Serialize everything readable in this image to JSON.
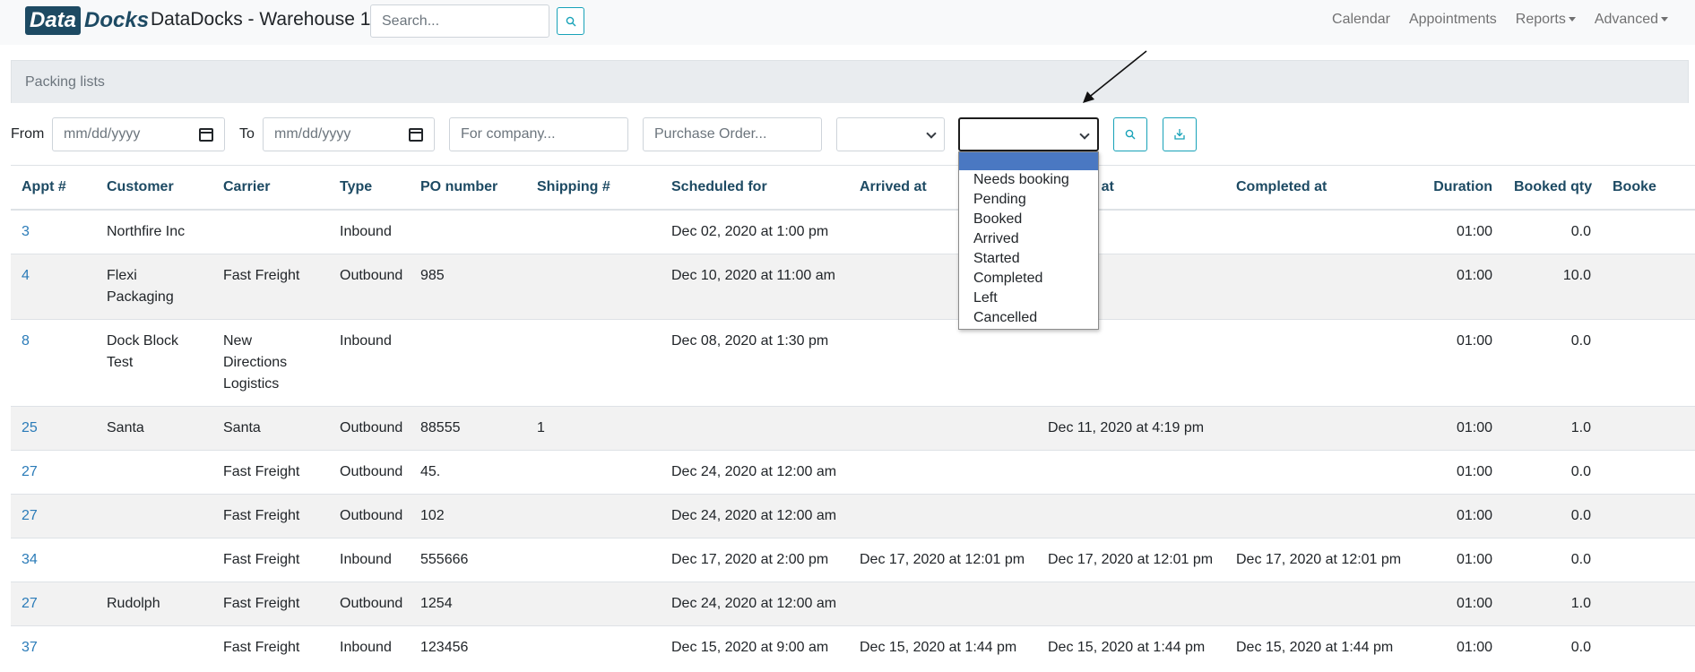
{
  "header": {
    "logo_part1": "Data",
    "logo_part2": "Docks",
    "title": "DataDocks - Warehouse 1",
    "search_placeholder": "Search...",
    "nav": [
      "Calendar",
      "Appointments",
      "Reports",
      "Advanced"
    ]
  },
  "card": {
    "title": "Packing lists"
  },
  "filters": {
    "from_label": "From",
    "to_label": "To",
    "from_placeholder": "mm/dd/yyyy",
    "to_placeholder": "mm/dd/yyyy",
    "company_placeholder": "For company...",
    "po_placeholder": "Purchase Order...",
    "type_select_value": "",
    "status_select_value": "",
    "status_options": [
      "",
      "Needs booking",
      "Pending",
      "Booked",
      "Arrived",
      "Started",
      "Completed",
      "Left",
      "Cancelled"
    ]
  },
  "table": {
    "columns": [
      "Appt #",
      "Customer",
      "Carrier",
      "Type",
      "PO number",
      "Shipping #",
      "Scheduled for",
      "Arrived at",
      "Started at",
      "Completed at",
      "Duration",
      "Booked qty",
      "Booked"
    ],
    "visible_headers": {
      "started": "at",
      "last": "Booke"
    },
    "rows": [
      {
        "appt": "3",
        "customer": "Northfire Inc",
        "carrier": "",
        "type": "Inbound",
        "po": "",
        "shipping": "",
        "scheduled": "Dec 02, 2020 at 1:00 pm",
        "arrived": "",
        "started": "",
        "completed": "",
        "duration": "01:00",
        "qty": "0.0"
      },
      {
        "appt": "4",
        "customer": "Flexi Packaging",
        "carrier": "Fast Freight",
        "type": "Outbound",
        "po": "985",
        "shipping": "",
        "scheduled": "Dec 10, 2020 at 11:00 am",
        "arrived": "",
        "started": "",
        "completed": "",
        "duration": "01:00",
        "qty": "10.0"
      },
      {
        "appt": "8",
        "customer": "Dock Block Test",
        "carrier": "New Directions Logistics",
        "type": "Inbound",
        "po": "",
        "shipping": "",
        "scheduled": "Dec 08, 2020 at 1:30 pm",
        "arrived": "",
        "started": "",
        "completed": "",
        "duration": "01:00",
        "qty": "0.0"
      },
      {
        "appt": "25",
        "customer": "Santa",
        "carrier": "Santa",
        "type": "Outbound",
        "po": "88555",
        "shipping": "1",
        "scheduled": "",
        "arrived": "",
        "started": "Dec 11, 2020 at 4:19 pm",
        "completed": "",
        "duration": "01:00",
        "qty": "1.0"
      },
      {
        "appt": "27",
        "customer": "",
        "carrier": "Fast Freight",
        "type": "Outbound",
        "po": "45.",
        "shipping": "",
        "scheduled": "Dec 24, 2020 at 12:00 am",
        "arrived": "",
        "started": "",
        "completed": "",
        "duration": "01:00",
        "qty": "0.0"
      },
      {
        "appt": "27",
        "customer": "",
        "carrier": "Fast Freight",
        "type": "Outbound",
        "po": "102",
        "shipping": "",
        "scheduled": "Dec 24, 2020 at 12:00 am",
        "arrived": "",
        "started": "",
        "completed": "",
        "duration": "01:00",
        "qty": "0.0"
      },
      {
        "appt": "34",
        "customer": "",
        "carrier": "Fast Freight",
        "type": "Inbound",
        "po": "555666",
        "shipping": "",
        "scheduled": "Dec 17, 2020 at 2:00 pm",
        "arrived": "Dec 17, 2020 at 12:01 pm",
        "started": "Dec 17, 2020 at 12:01 pm",
        "completed": "Dec 17, 2020 at 12:01 pm",
        "duration": "01:00",
        "qty": "0.0"
      },
      {
        "appt": "27",
        "customer": "Rudolph",
        "carrier": "Fast Freight",
        "type": "Outbound",
        "po": "1254",
        "shipping": "",
        "scheduled": "Dec 24, 2020 at 12:00 am",
        "arrived": "",
        "started": "",
        "completed": "",
        "duration": "01:00",
        "qty": "1.0"
      },
      {
        "appt": "37",
        "customer": "",
        "carrier": "Fast Freight",
        "type": "Inbound",
        "po": "123456",
        "shipping": "",
        "scheduled": "Dec 15, 2020 at 9:00 am",
        "arrived": "Dec 15, 2020 at 1:44 pm",
        "started": "Dec 15, 2020 at 1:44 pm",
        "completed": "Dec 15, 2020 at 1:44 pm",
        "duration": "01:00",
        "qty": "0.0"
      }
    ]
  },
  "colors": {
    "brand": "#1d4a63",
    "link": "#2a7bb8",
    "info": "#17a2b8",
    "selected_option": "#4a78c2"
  }
}
